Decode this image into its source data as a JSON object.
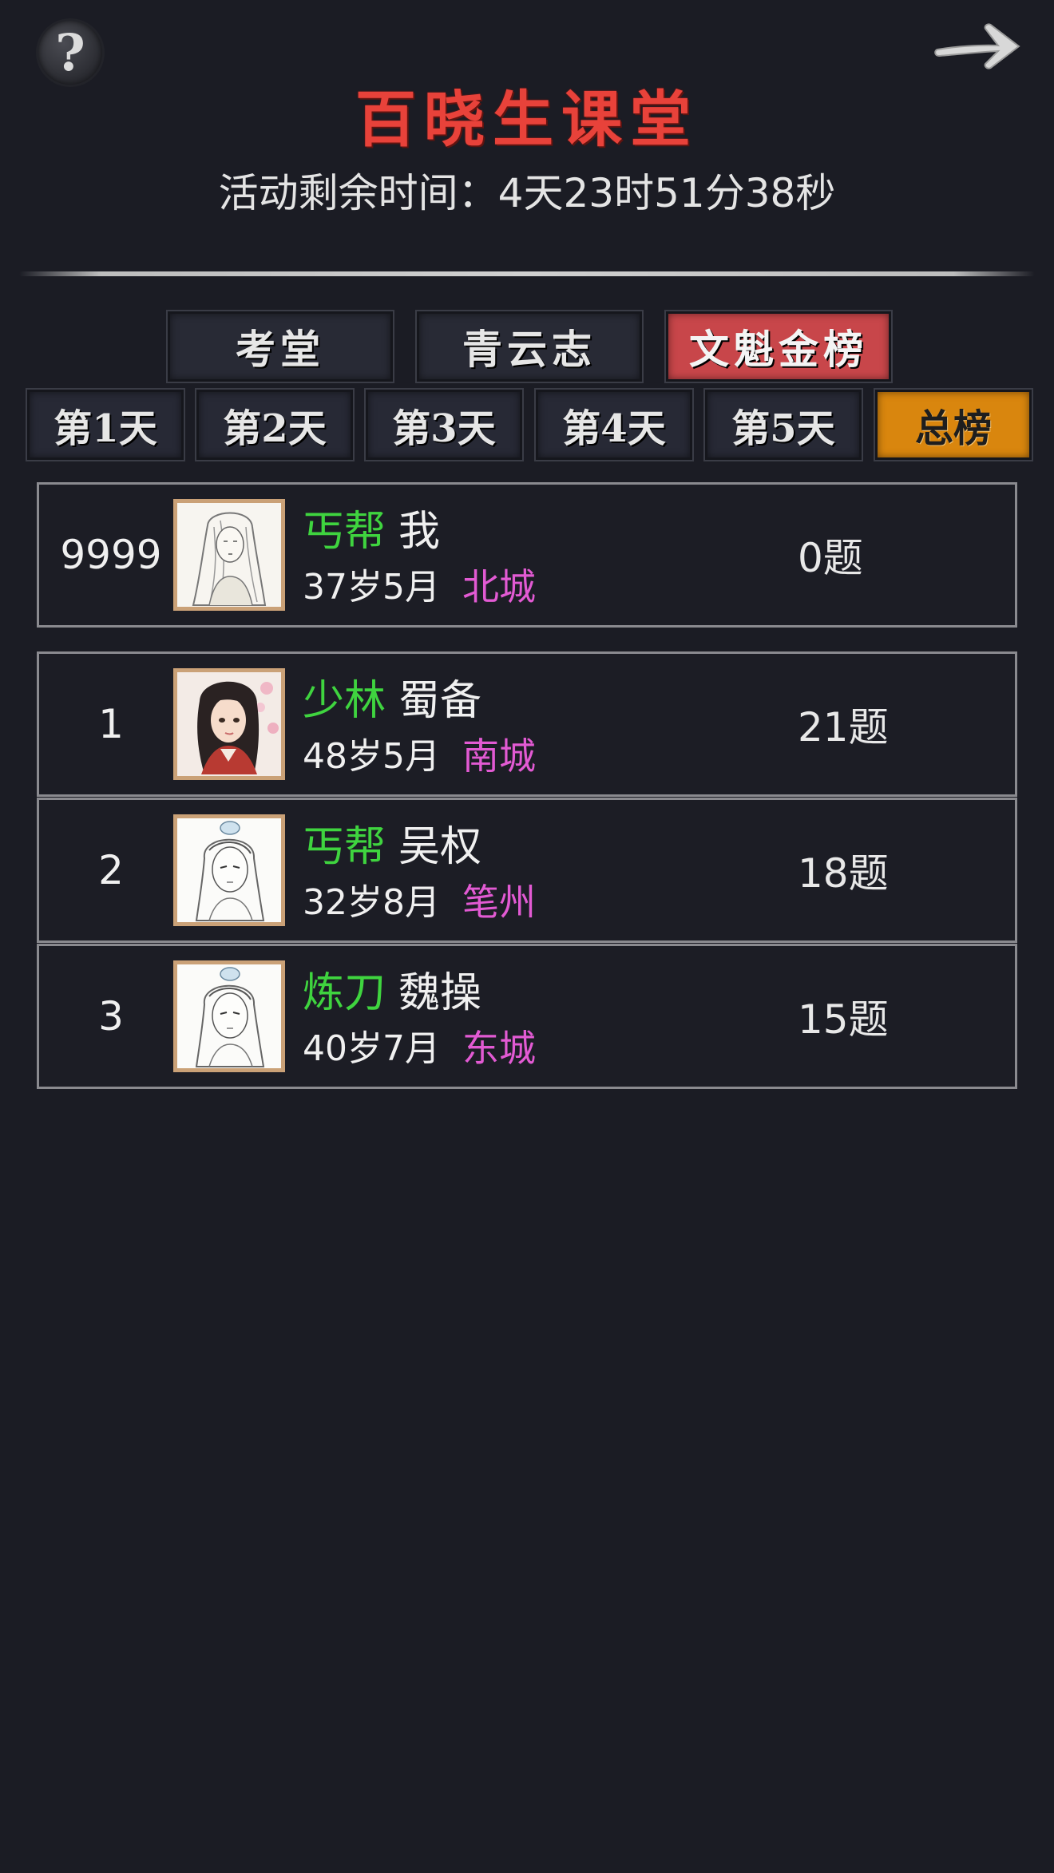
{
  "header": {
    "title": "百晓生课堂",
    "timer": "活动剩余时间：4天23时51分38秒",
    "help_glyph": "?",
    "help_icon": "question-mark-icon",
    "next_icon": "arrow-right-icon"
  },
  "tabs": [
    {
      "label": "考堂",
      "active": false
    },
    {
      "label": "青云志",
      "active": false
    },
    {
      "label": "文魁金榜",
      "active": true
    }
  ],
  "days": [
    {
      "label": "第1天",
      "active": false
    },
    {
      "label": "第2天",
      "active": false
    },
    {
      "label": "第3天",
      "active": false
    },
    {
      "label": "第4天",
      "active": false
    },
    {
      "label": "第5天",
      "active": false
    },
    {
      "label": "总榜",
      "active": true
    }
  ],
  "me": {
    "rank": "9999",
    "sect": "丐帮",
    "name": "我",
    "age": "37岁5月",
    "city": "北城",
    "score": "0题",
    "avatar": "portrait-long-hair-sketch"
  },
  "rankings": [
    {
      "rank": "1",
      "sect": "少林",
      "name": "蜀备",
      "age": "48岁5月",
      "city": "南城",
      "score": "21题",
      "avatar": "portrait-color-woman"
    },
    {
      "rank": "2",
      "sect": "丐帮",
      "name": "吴权",
      "age": "32岁8月",
      "city": "笔州",
      "score": "18题",
      "avatar": "portrait-topknot-sketch"
    },
    {
      "rank": "3",
      "sect": "炼刀",
      "name": "魏操",
      "age": "40岁7月",
      "city": "东城",
      "score": "15题",
      "avatar": "portrait-topknot-sketch"
    }
  ],
  "colors": {
    "background": "#1b1c24",
    "title": "#e8423a",
    "tab_active": "#c8464a",
    "day_active": "#d9860e",
    "sect": "#3fd43f",
    "city": "#e25ad3"
  }
}
